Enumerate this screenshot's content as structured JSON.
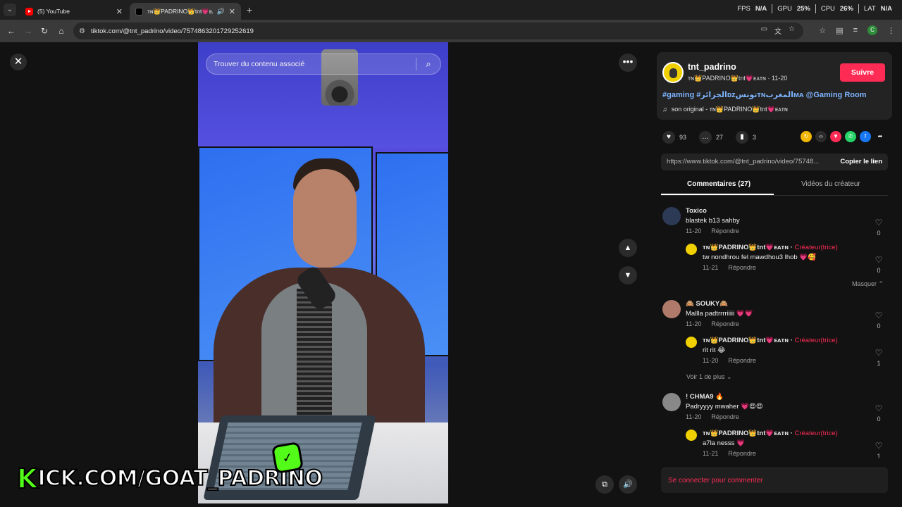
{
  "browser": {
    "tabs": [
      {
        "title": "(5) YouTube",
        "favicon": "youtube-icon"
      },
      {
        "title": "ᴛɴ👑PADRINO👑tnt💗ᴇᴀᴛɴ",
        "favicon": "tiktok-icon"
      }
    ],
    "url": "tiktok.com/@tnt_padrino/video/7574863201729252619",
    "osd": {
      "fps_label": "FPS",
      "fps": "N/A",
      "gpu_label": "GPU",
      "gpu": "25%",
      "cpu_label": "CPU",
      "cpu": "26%",
      "lat_label": "LAT",
      "lat": "N/A"
    },
    "profile_initial": "C"
  },
  "video": {
    "search_placeholder": "Trouver du contenu associé",
    "watermark": {
      "k": "K",
      "text": "ICK.COM/GOAT_PADRINO"
    }
  },
  "author": {
    "handle": "tnt_padrino",
    "display": "ᴛɴ👑PADRINO👑tnt💗ᴇᴀᴛɴ · 11-20",
    "follow_label": "Suivre",
    "hashtags": "#gaming #الجزائرᴅᴢتونسᴛɴالمغربᴍᴀ @Gaming Room",
    "music": "son original - ᴛɴ👑PADRINO👑tnt💗ᴇᴀᴛɴ"
  },
  "stats": {
    "likes": "93",
    "comments": "27",
    "saves": "3"
  },
  "share": {
    "link": "https://www.tiktok.com/@tnt_padrino/video/75748...",
    "copy_label": "Copier le lien"
  },
  "tabs": {
    "comments": "Commentaires (27)",
    "creator_videos": "Vidéos du créateur"
  },
  "comments": [
    {
      "name": "Toxico",
      "text": "blastek b13 sahby",
      "date": "11-20",
      "reply": "Répondre",
      "likes": "0"
    },
    {
      "name": "ᴛɴ👑PADRINO👑tnt💗ᴇᴀᴛɴ · ",
      "badge": "Créateur(trice)",
      "text": "tw nondhrou fel mawdhou3 lhob 💗🥰",
      "date": "11-21",
      "reply": "Répondre",
      "likes": "0"
    },
    {
      "name": "🙈 SOUKY🙈",
      "text": "Mallla padtrrrriiiii 💗💗",
      "date": "11-20",
      "reply": "Répondre",
      "likes": "0"
    },
    {
      "name": "ᴛɴ👑PADRINO👑tnt💗ᴇᴀᴛɴ · ",
      "badge": "Créateur(trice)",
      "text": "rit rit 😂",
      "date": "11-20",
      "reply": "Répondre",
      "likes": "1"
    },
    {
      "name": "! CHMA9 🔥",
      "text": "Padryyyy mwaher 💗😍😍",
      "date": "11-20",
      "reply": "Répondre",
      "likes": "0"
    },
    {
      "name": "ᴛɴ👑PADRINO👑tnt💗ᴇᴀᴛɴ · ",
      "badge": "Créateur(trice)",
      "text": "a7la nesss 💗",
      "date": "11-21",
      "reply": "Répondre",
      "likes": "1"
    }
  ],
  "hide_label": "Masquer ⌃",
  "more_label": "Voir 1 de plus ⌄",
  "login_label": "Se connecter pour commenter"
}
